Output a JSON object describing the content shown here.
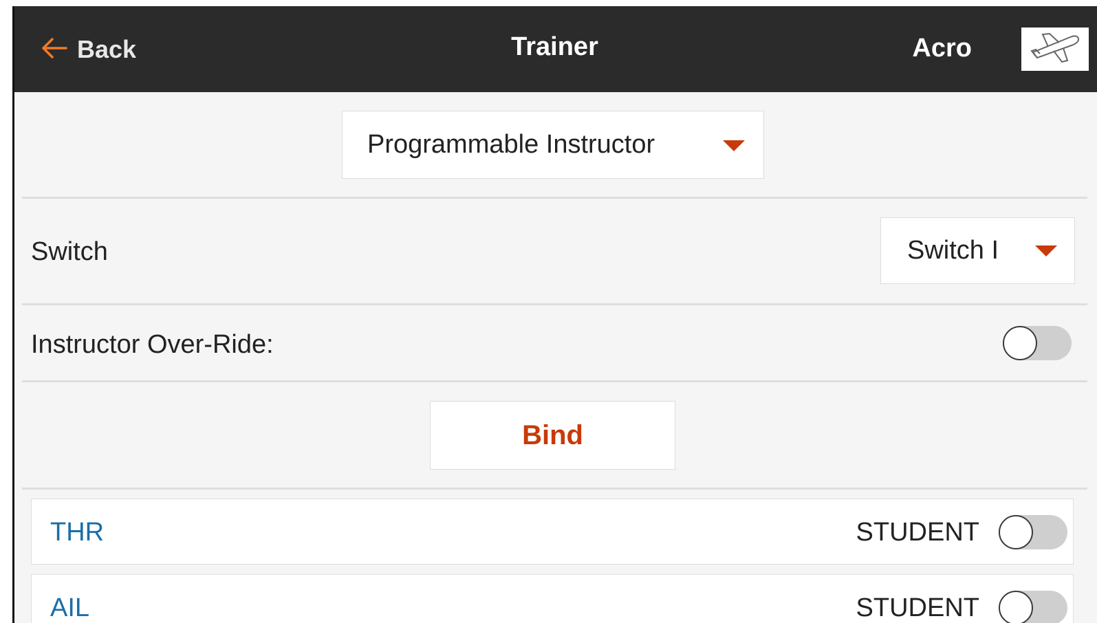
{
  "header": {
    "back_label": "Back",
    "title": "Trainer",
    "model_name": "Acro",
    "model_icon": "airplane-icon"
  },
  "trainer_mode": {
    "selected": "Programmable Instructor"
  },
  "switch_row": {
    "label": "Switch",
    "selected": "Switch I"
  },
  "override_row": {
    "label": "Instructor Over-Ride:",
    "enabled": false
  },
  "bind": {
    "label": "Bind"
  },
  "channels": [
    {
      "name": "THR",
      "state": "STUDENT",
      "enabled": false
    },
    {
      "name": "AIL",
      "state": "STUDENT",
      "enabled": false
    }
  ],
  "colors": {
    "header_bg": "#2b2b2b",
    "accent": "#c83a0a",
    "channel_name": "#1b6ea8",
    "back_arrow": "#f07a2a"
  }
}
